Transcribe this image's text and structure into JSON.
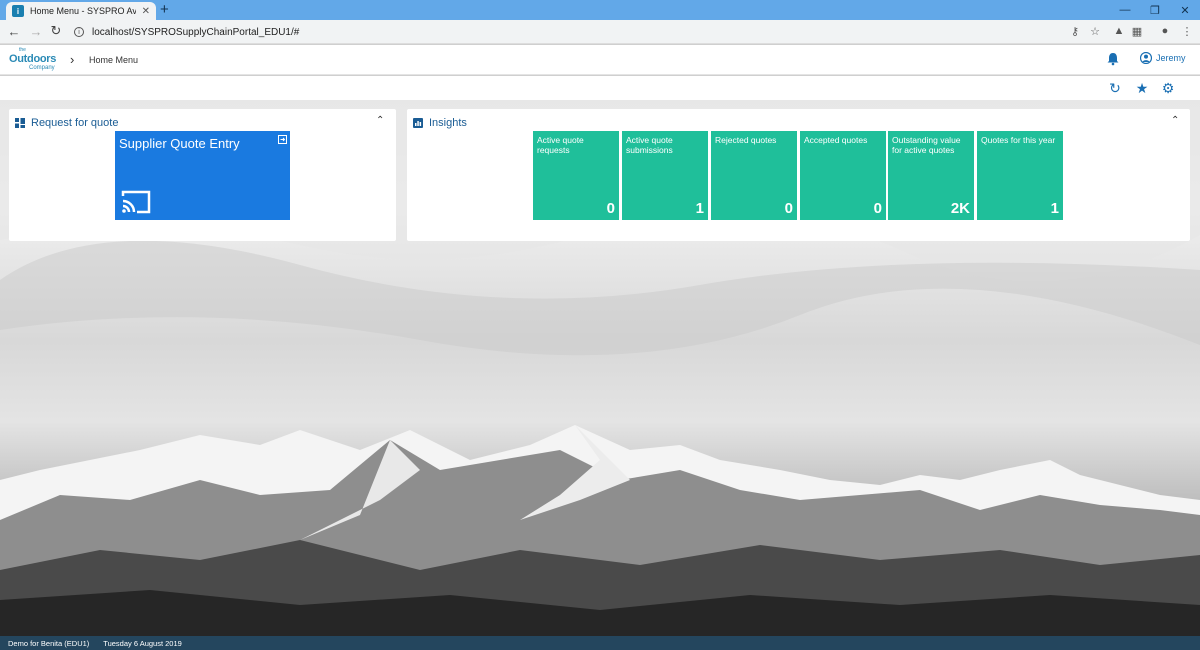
{
  "browser": {
    "tab_title": "Home Menu - SYSPRO Avanti",
    "tab_close": "✕",
    "new_tab": "+",
    "url": "localhost/SYSPROSupplyChainPortal_EDU1/#"
  },
  "header": {
    "logo_small": "the",
    "logo_main": "Outdoors",
    "logo_company": "Company",
    "breadcrumb": "Home Menu",
    "user_name": "Jeremy"
  },
  "rfq_panel": {
    "title": "Request for quote",
    "tile": {
      "title": "Supplier Quote Entry",
      "color": "#1a7ae0"
    }
  },
  "insights_panel": {
    "title": "Insights",
    "tile_color": "#1fbf9a",
    "tiles": [
      {
        "label": "Active quote requests",
        "value": "0"
      },
      {
        "label": "Active quote submissions",
        "value": "1"
      },
      {
        "label": "Rejected quotes",
        "value": "0"
      },
      {
        "label": "Accepted quotes",
        "value": "0"
      },
      {
        "label": "Outstanding value for active quotes",
        "value": "2K"
      },
      {
        "label": "Quotes for this year",
        "value": "1"
      }
    ]
  },
  "status": {
    "company": "Demo for Benita (EDU1)",
    "date": "Tuesday 6  August 2019"
  },
  "colors": {
    "accent": "#1a6fb3",
    "status_bar": "#24465e"
  }
}
